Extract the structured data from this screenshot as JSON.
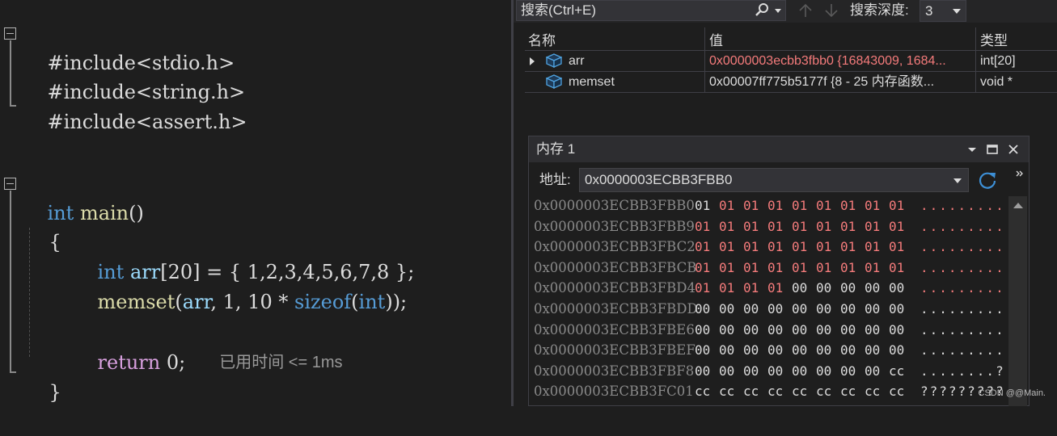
{
  "editor": {
    "lines": {
      "inc1": {
        "kw": "#include",
        "hdr": "<stdio.h>"
      },
      "inc2": {
        "kw": "#include",
        "hdr": "<string.h>"
      },
      "inc3": {
        "kw": "#include",
        "hdr": "<assert.h>"
      },
      "main_sig": {
        "type": "int",
        "name": "main",
        "parens": "()"
      },
      "open_brace": "{",
      "decl": {
        "type": "int",
        "name": "arr",
        "rest": "[20] = { 1,2,3,4,5,6,7,8 };"
      },
      "call": {
        "fn": "memset",
        "p1": "(",
        "arr": "arr",
        "p2": ", 1, 10 * ",
        "sizeof": "sizeof",
        "p3": "(",
        "int": "int",
        "p4": "));"
      },
      "ret": {
        "kw": "return",
        "val": " 0;"
      },
      "close_brace": "}"
    },
    "perf_hint": "已用时间 <= 1ms"
  },
  "watch": {
    "search_placeholder": "搜索(Ctrl+E)",
    "depth_label": "搜索深度:",
    "depth_value": "3",
    "columns": {
      "name": "名称",
      "value": "值",
      "type": "类型"
    },
    "rows": [
      {
        "name": "arr",
        "value": "0x0000003ecbb3fbb0 {16843009, 1684...",
        "type": "int[20]",
        "changed": true
      },
      {
        "name": "memset",
        "value": "0x00007ff775b5177f {8 - 25 内存函数...",
        "type": "void *",
        "changed": false
      }
    ]
  },
  "memory": {
    "title": "内存 1",
    "address_label": "地址:",
    "address_value": "0x0000003ECBB3FBB0",
    "rows": [
      {
        "addr": "0x0000003ECBB3FBB0",
        "bytes": [
          "01",
          "01",
          "01",
          "01",
          "01",
          "01",
          "01",
          "01",
          "01"
        ],
        "changed": [
          false,
          true,
          true,
          true,
          true,
          true,
          true,
          true,
          true
        ],
        "ascii": ".........",
        "ascii_changed": true
      },
      {
        "addr": "0x0000003ECBB3FBB9",
        "bytes": [
          "01",
          "01",
          "01",
          "01",
          "01",
          "01",
          "01",
          "01",
          "01"
        ],
        "changed": [
          true,
          true,
          true,
          true,
          true,
          true,
          true,
          true,
          true
        ],
        "ascii": ".........",
        "ascii_changed": true
      },
      {
        "addr": "0x0000003ECBB3FBC2",
        "bytes": [
          "01",
          "01",
          "01",
          "01",
          "01",
          "01",
          "01",
          "01",
          "01"
        ],
        "changed": [
          true,
          true,
          true,
          true,
          true,
          true,
          true,
          true,
          true
        ],
        "ascii": ".........",
        "ascii_changed": true
      },
      {
        "addr": "0x0000003ECBB3FBCB",
        "bytes": [
          "01",
          "01",
          "01",
          "01",
          "01",
          "01",
          "01",
          "01",
          "01"
        ],
        "changed": [
          true,
          true,
          true,
          true,
          true,
          true,
          true,
          true,
          true
        ],
        "ascii": ".........",
        "ascii_changed": true
      },
      {
        "addr": "0x0000003ECBB3FBD4",
        "bytes": [
          "01",
          "01",
          "01",
          "01",
          "00",
          "00",
          "00",
          "00",
          "00"
        ],
        "changed": [
          true,
          true,
          true,
          true,
          false,
          false,
          false,
          false,
          false
        ],
        "ascii": ".........",
        "ascii_changed": true
      },
      {
        "addr": "0x0000003ECBB3FBDD",
        "bytes": [
          "00",
          "00",
          "00",
          "00",
          "00",
          "00",
          "00",
          "00",
          "00"
        ],
        "changed": [
          false,
          false,
          false,
          false,
          false,
          false,
          false,
          false,
          false
        ],
        "ascii": ".........",
        "ascii_changed": false
      },
      {
        "addr": "0x0000003ECBB3FBE6",
        "bytes": [
          "00",
          "00",
          "00",
          "00",
          "00",
          "00",
          "00",
          "00",
          "00"
        ],
        "changed": [
          false,
          false,
          false,
          false,
          false,
          false,
          false,
          false,
          false
        ],
        "ascii": ".........",
        "ascii_changed": false
      },
      {
        "addr": "0x0000003ECBB3FBEF",
        "bytes": [
          "00",
          "00",
          "00",
          "00",
          "00",
          "00",
          "00",
          "00",
          "00"
        ],
        "changed": [
          false,
          false,
          false,
          false,
          false,
          false,
          false,
          false,
          false
        ],
        "ascii": ".........",
        "ascii_changed": false
      },
      {
        "addr": "0x0000003ECBB3FBF8",
        "bytes": [
          "00",
          "00",
          "00",
          "00",
          "00",
          "00",
          "00",
          "00",
          "cc"
        ],
        "changed": [
          false,
          false,
          false,
          false,
          false,
          false,
          false,
          false,
          false
        ],
        "ascii": "........?",
        "ascii_changed": false
      },
      {
        "addr": "0x0000003ECBB3FC01",
        "bytes": [
          "cc",
          "cc",
          "cc",
          "cc",
          "cc",
          "cc",
          "cc",
          "cc",
          "cc"
        ],
        "changed": [
          false,
          false,
          false,
          false,
          false,
          false,
          false,
          false,
          false
        ],
        "ascii": "?????????",
        "ascii_changed": false
      }
    ],
    "watermark": "CSDN @@Main."
  },
  "icons": {
    "search": "search-icon",
    "up": "arrow-up-icon",
    "down": "arrow-down-icon",
    "refresh": "refresh-icon",
    "variable": "variable-cube-icon"
  },
  "colors": {
    "changed": "#f47b7b",
    "keyword": "#569cd6",
    "function": "#dcdcaa",
    "number": "#b5cea8"
  }
}
